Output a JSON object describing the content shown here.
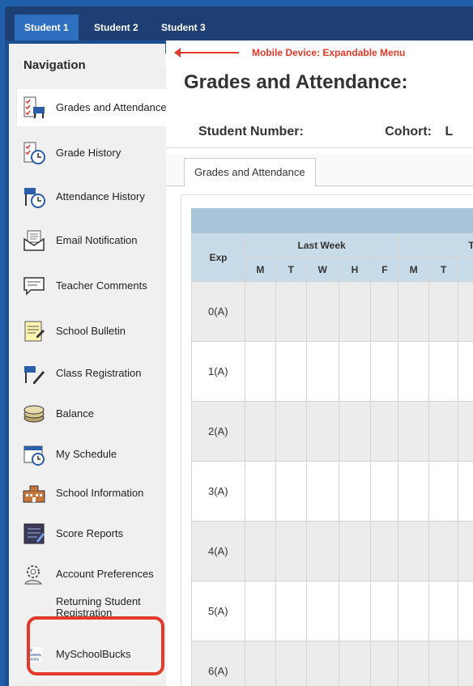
{
  "student_tabs": [
    "Student 1",
    "Student 2",
    "Student 3"
  ],
  "sidebar": {
    "title": "Navigation",
    "items": [
      {
        "label": "Grades and Attendance",
        "icon": "grades-attendance-icon",
        "active": true
      },
      {
        "label": "Grade History",
        "icon": "grade-history-icon"
      },
      {
        "label": "Attendance History",
        "icon": "attendance-history-icon"
      },
      {
        "label": "Email Notification",
        "icon": "email-icon"
      },
      {
        "label": "Teacher Comments",
        "icon": "comments-icon"
      },
      {
        "label": "School Bulletin",
        "icon": "bulletin-icon"
      },
      {
        "label": "Class Registration",
        "icon": "class-registration-icon"
      },
      {
        "label": "Balance",
        "icon": "balance-icon"
      },
      {
        "label": "My Schedule",
        "icon": "schedule-icon"
      },
      {
        "label": "School Information",
        "icon": "school-icon"
      },
      {
        "label": "Score Reports",
        "icon": "score-reports-icon"
      },
      {
        "label": "Account Preferences",
        "icon": "gear-icon"
      },
      {
        "label": "Returning Student Registration",
        "icon": ""
      },
      {
        "label": "MySchoolBucks",
        "icon": "myschoolbucks-logo-icon",
        "logo_text": "MY SCHOOL BUCKS"
      }
    ]
  },
  "annotation": "Mobile Device: Expandable Menu",
  "main": {
    "title": "Grades and Attendance:",
    "student_number_label": "Student Number:",
    "cohort_label": "Cohort:",
    "cohort_value_partial": "L",
    "content_tab": "Grades and Attendance"
  },
  "grid": {
    "exp_header": "Exp",
    "last_week_header": "Last Week",
    "this_week_header": "This",
    "last_week_days": [
      "M",
      "T",
      "W",
      "H",
      "F"
    ],
    "this_week_days": [
      "M",
      "T"
    ],
    "periods": [
      "0(A)",
      "1(A)",
      "2(A)",
      "3(A)",
      "4(A)",
      "5(A)",
      "6(A)"
    ]
  },
  "colors": {
    "topbar": "#1e3f74",
    "active_student_tab": "#2f6fc0",
    "highlight": "#e23a2a",
    "annotation": "#e23a2a",
    "grid_band": "#a9c4d8",
    "grid_header": "#c7dce8"
  }
}
